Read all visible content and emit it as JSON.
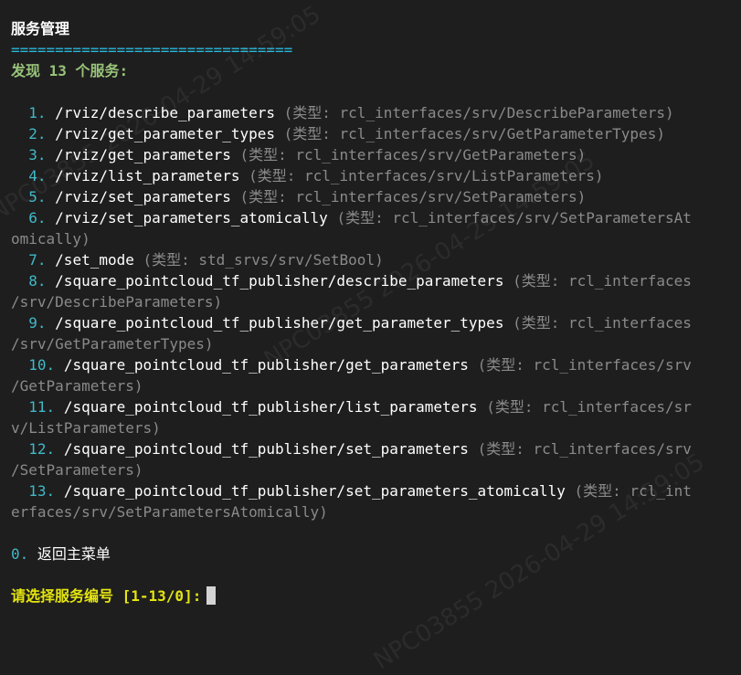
{
  "header": {
    "title": "服务管理",
    "separator": "================================",
    "found_text": "发现 13 个服务:"
  },
  "services": [
    {
      "num": "1.",
      "path": "/rviz/describe_parameters",
      "type": "(类型: rcl_interfaces/srv/DescribeParameters)"
    },
    {
      "num": "2.",
      "path": "/rviz/get_parameter_types",
      "type": "(类型: rcl_interfaces/srv/GetParameterTypes)"
    },
    {
      "num": "3.",
      "path": "/rviz/get_parameters",
      "type": "(类型: rcl_interfaces/srv/GetParameters)"
    },
    {
      "num": "4.",
      "path": "/rviz/list_parameters",
      "type": "(类型: rcl_interfaces/srv/ListParameters)"
    },
    {
      "num": "5.",
      "path": "/rviz/set_parameters",
      "type": "(类型: rcl_interfaces/srv/SetParameters)"
    },
    {
      "num": "6.",
      "path": "/rviz/set_parameters_atomically",
      "type": "(类型: rcl_interfaces/srv/SetParametersAt",
      "type_cont": "omically)"
    },
    {
      "num": "7.",
      "path": "/set_mode",
      "type": "(类型: std_srvs/srv/SetBool)"
    },
    {
      "num": "8.",
      "path": "/square_pointcloud_tf_publisher/describe_parameters",
      "type": "(类型: rcl_interfaces",
      "type_cont": "/srv/DescribeParameters)"
    },
    {
      "num": "9.",
      "path": "/square_pointcloud_tf_publisher/get_parameter_types",
      "type": "(类型: rcl_interfaces",
      "type_cont": "/srv/GetParameterTypes)"
    },
    {
      "num": "10.",
      "path": "/square_pointcloud_tf_publisher/get_parameters",
      "type": "(类型: rcl_interfaces/srv",
      "type_cont": "/GetParameters)"
    },
    {
      "num": "11.",
      "path": "/square_pointcloud_tf_publisher/list_parameters",
      "type": "(类型: rcl_interfaces/sr",
      "type_cont": "v/ListParameters)"
    },
    {
      "num": "12.",
      "path": "/square_pointcloud_tf_publisher/set_parameters",
      "type": "(类型: rcl_interfaces/srv",
      "type_cont": "/SetParameters)"
    },
    {
      "num": "13.",
      "path": "/square_pointcloud_tf_publisher/set_parameters_atomically",
      "type": "(类型: rcl_int",
      "type_cont": "erfaces/srv/SetParametersAtomically)"
    }
  ],
  "back": {
    "num": "0.",
    "label": "返回主菜单"
  },
  "prompt": {
    "text": "请选择服务编号 [1-13/0]:"
  },
  "watermark": {
    "text": "NPC03855 2026-04-29 14:59:05"
  }
}
